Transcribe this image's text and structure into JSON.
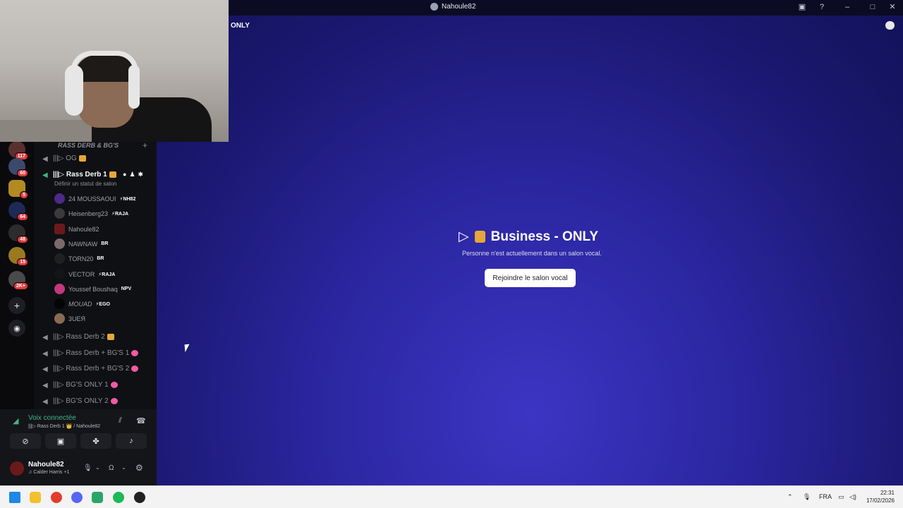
{
  "window": {
    "title": "Nahoule82"
  },
  "server_badges": [
    "117",
    "60",
    "5",
    "64",
    "48",
    "15",
    "2K+"
  ],
  "channels": {
    "category": "RASS DERB & BG'S",
    "og": "|||▷ OG",
    "active": {
      "name": "|||▷ Rass Derb 1",
      "status_hint": "Définir un statut de salon"
    },
    "members": [
      {
        "name": "24 MOUSSAOUI",
        "tag": "⚡NH82"
      },
      {
        "name": "Heisenberg23",
        "tag": "⚡RAJA"
      },
      {
        "name": "Nahoule82",
        "tag": ""
      },
      {
        "name": "NAWNAW",
        "tag": "BR"
      },
      {
        "name": "TORN20",
        "tag": "BR"
      },
      {
        "name": "VECTOR",
        "tag": "⚡RAJA"
      },
      {
        "name": "Youssef Boushaq",
        "tag": "NPV"
      },
      {
        "name": "MOUAD",
        "tag": "⚡EGO"
      },
      {
        "name": "3UEЯ",
        "tag": ""
      }
    ],
    "others": [
      "|||▷ Rass Derb 2",
      "|||▷ Rass Derb + BG'S 1",
      "|||▷ Rass Derb + BG'S 2",
      "|||▷ BG'S ONLY 1",
      "|||▷ BG'S ONLY 2"
    ]
  },
  "voice": {
    "status": "Voix connectée",
    "location": "|||▷ Rass Derb 1 👑 / Nahoule82"
  },
  "user": {
    "name": "Nahoule82",
    "activity": "♫ Calder Harris +1"
  },
  "main": {
    "header_fragment": "ONLY",
    "title": "Business - ONLY",
    "subtitle": "Personne n'est actuellement dans un salon vocal.",
    "join_label": "Rejoindre le salon vocal"
  },
  "taskbar": {
    "lang": "FRA",
    "time": "22:31",
    "date": "17/02/2026"
  },
  "colors": {
    "accent_green": "#43b581",
    "badge_red": "#e03a3e",
    "main_bg": "#2b26a0"
  }
}
